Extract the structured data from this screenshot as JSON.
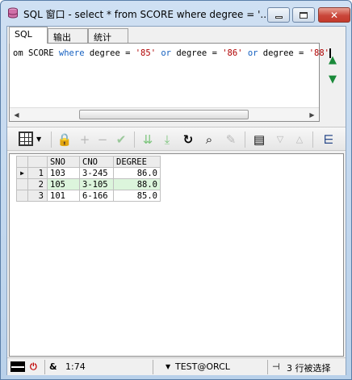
{
  "window": {
    "title": "SQL 窗口 - select * from SCORE where degree = '...",
    "min_glyph": "",
    "close_glyph": "✕"
  },
  "tabs": [
    {
      "label": "SQL",
      "active": true
    },
    {
      "label": "输出",
      "active": false
    },
    {
      "label": "统计",
      "active": false
    }
  ],
  "editor": {
    "seg1": "om SCORE ",
    "kw_where": "where",
    "seg2": " degree = ",
    "str1": "'85'",
    "kw_or1": " or",
    "seg3": " degree = ",
    "str2": "'86'",
    "kw_or2": " or",
    "seg4": " degree = ",
    "str3": "'88'"
  },
  "side_buttons": {
    "up": "▲",
    "down": "▼"
  },
  "grid": {
    "columns": [
      "SNO",
      "CNO",
      "DEGREE"
    ],
    "rows": [
      {
        "rownum": "1",
        "sno": "103",
        "cno": "3-245",
        "degree": "86.0"
      },
      {
        "rownum": "2",
        "sno": "105",
        "cno": "3-105",
        "degree": "88.0"
      },
      {
        "rownum": "3",
        "sno": "101",
        "cno": "6-166",
        "degree": "85.0"
      }
    ],
    "current_row_marker": "▶",
    "highlight_color": "#dcf5dc"
  },
  "status": {
    "position": "1:74",
    "connection": "TEST@ORCL",
    "rows_info": "3 行被选择",
    "amp": "&"
  },
  "colors": {
    "keyword": "#1560c0",
    "string": "#b00000",
    "accent_green": "#1a8a3a"
  }
}
